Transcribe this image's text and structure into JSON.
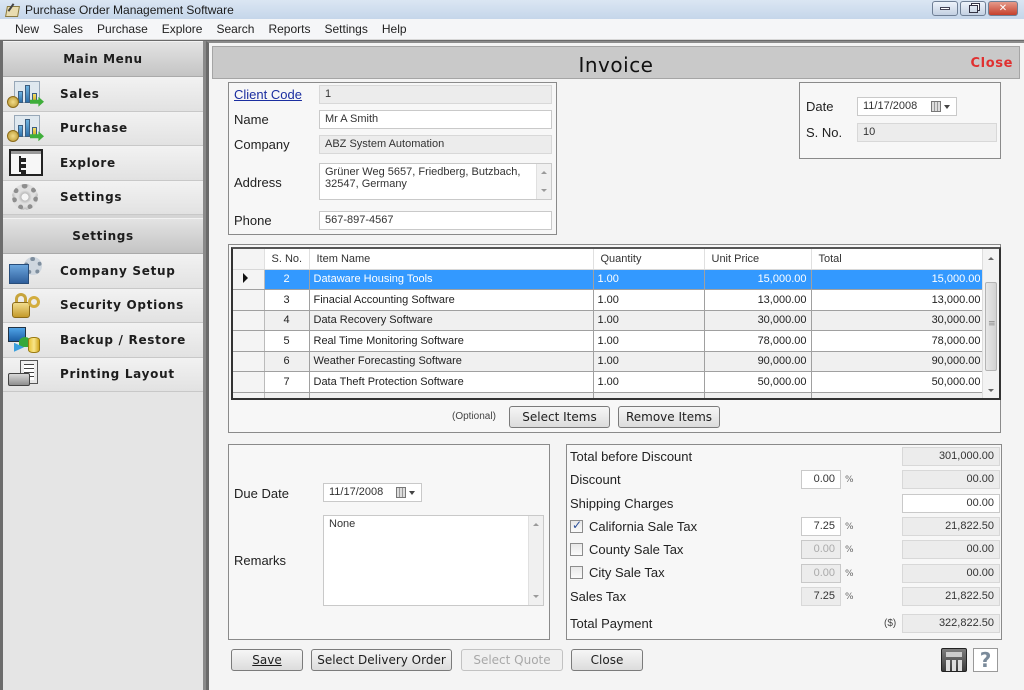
{
  "window": {
    "title": "Purchase Order Management Software",
    "controls": {
      "minimize": "minimize",
      "restore": "restore",
      "close": "close"
    }
  },
  "menubar": [
    "New",
    "Sales",
    "Purchase",
    "Explore",
    "Search",
    "Reports",
    "Settings",
    "Help"
  ],
  "sidebar": {
    "main_menu": {
      "header": "Main Menu",
      "items": [
        {
          "label": "Sales",
          "icon": "sales-chart-icon"
        },
        {
          "label": "Purchase",
          "icon": "purchase-chart-icon"
        },
        {
          "label": "Explore",
          "icon": "tree-explorer-icon"
        },
        {
          "label": "Settings",
          "icon": "gear-icon"
        }
      ]
    },
    "settings_menu": {
      "header": "Settings",
      "items": [
        {
          "label": "Company Setup",
          "icon": "building-gear-icon"
        },
        {
          "label": "Security Options",
          "icon": "lock-key-icon"
        },
        {
          "label": "Backup / Restore",
          "icon": "backup-database-icon"
        },
        {
          "label": "Printing Layout",
          "icon": "printer-icon"
        }
      ]
    }
  },
  "invoice": {
    "title": "Invoice",
    "close_link": "Close",
    "client": {
      "client_code_label": "Client Code",
      "client_code": "1",
      "name_label": "Name",
      "name": "Mr A Smith",
      "company_label": "Company",
      "company": "ABZ System Automation",
      "address_label": "Address",
      "address": "Grüner Weg 5657, Friedberg, Butzbach, 32547, Germany",
      "phone_label": "Phone",
      "phone": "567-897-4567"
    },
    "meta": {
      "date_label": "Date",
      "date": "11/17/2008",
      "sno_label": "S. No.",
      "sno": "10"
    },
    "items_table": {
      "columns": [
        "S. No.",
        "Item Name",
        "Quantity",
        "Unit Price",
        "Total"
      ],
      "selected_index": 0,
      "rows": [
        {
          "sno": "2",
          "item": "Dataware Housing Tools",
          "qty": "1.00",
          "unit_price": "15,000.00",
          "total": "15,000.00"
        },
        {
          "sno": "3",
          "item": "Finacial Accounting Software",
          "qty": "1.00",
          "unit_price": "13,000.00",
          "total": "13,000.00"
        },
        {
          "sno": "4",
          "item": "Data Recovery Software",
          "qty": "1.00",
          "unit_price": "30,000.00",
          "total": "30,000.00"
        },
        {
          "sno": "5",
          "item": "Real Time Monitoring Software",
          "qty": "1.00",
          "unit_price": "78,000.00",
          "total": "78,000.00"
        },
        {
          "sno": "6",
          "item": "Weather Forecasting Software",
          "qty": "1.00",
          "unit_price": "90,000.00",
          "total": "90,000.00"
        },
        {
          "sno": "7",
          "item": "Data Theft Protection Software",
          "qty": "1.00",
          "unit_price": "50,000.00",
          "total": "50,000.00"
        }
      ]
    },
    "item_actions": {
      "optional_label": "(Optional)",
      "select_items": "Select Items",
      "remove_items": "Remove Items"
    },
    "due": {
      "due_date_label": "Due Date",
      "due_date": "11/17/2008",
      "remarks_label": "Remarks",
      "remarks": "None"
    },
    "totals": {
      "total_before_discount_label": "Total before Discount",
      "total_before_discount": "301,000.00",
      "discount_label": "Discount",
      "discount_pct": "0.00",
      "discount_amount": "00.00",
      "shipping_label": "Shipping Charges",
      "shipping": "00.00",
      "california_label": "California Sale Tax",
      "california_checked": true,
      "california_pct": "7.25",
      "california_amount": "21,822.50",
      "county_label": "County Sale Tax",
      "county_checked": false,
      "county_pct": "0.00",
      "county_amount": "00.00",
      "city_label": "City Sale Tax",
      "city_checked": false,
      "city_pct": "0.00",
      "city_amount": "00.00",
      "sales_tax_label": "Sales Tax",
      "sales_tax_pct": "7.25",
      "sales_tax_amount": "21,822.50",
      "total_payment_label": "Total Payment",
      "currency": "($)",
      "total_payment": "322,822.50",
      "pct_symbol": "%"
    },
    "footer": {
      "save": "Save",
      "select_delivery_order": "Select Delivery Order",
      "select_quote": "Select Quote",
      "close": "Close",
      "help_glyph": "?"
    }
  }
}
